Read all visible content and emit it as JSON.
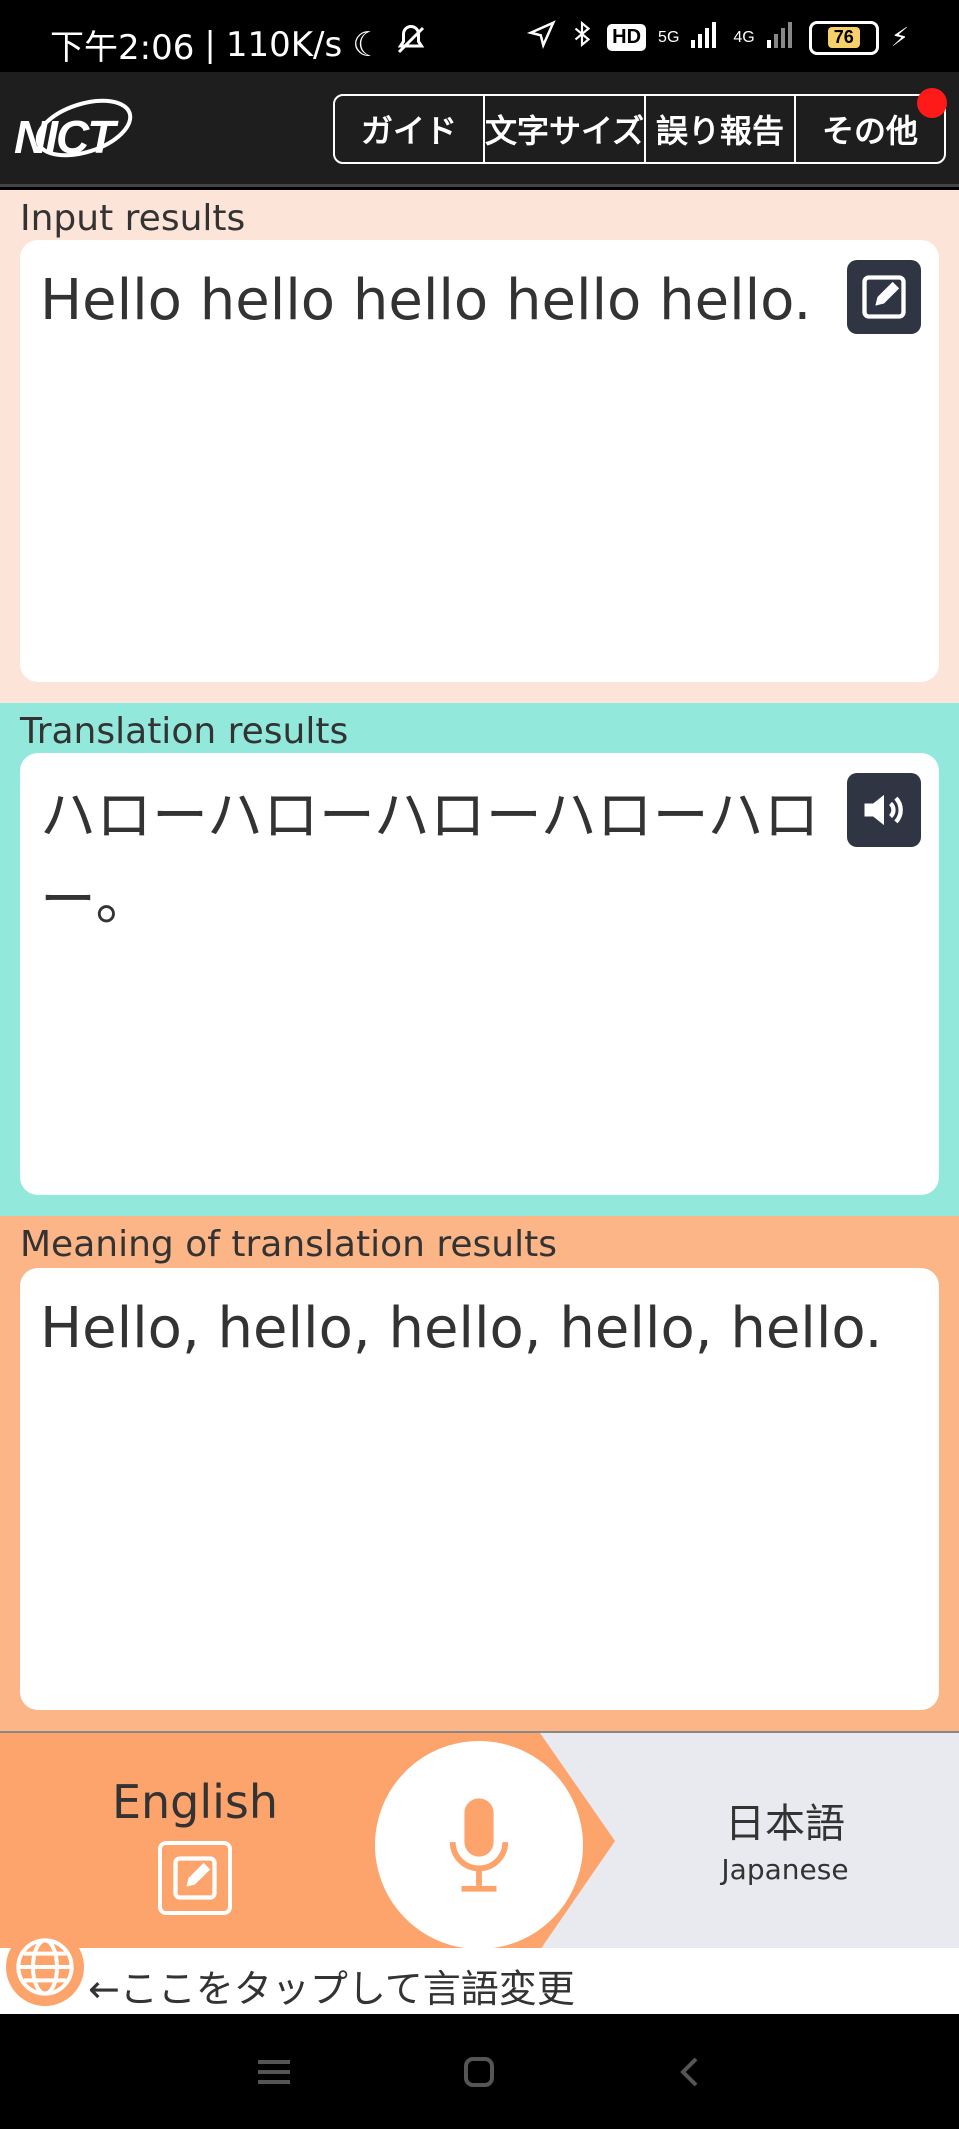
{
  "status_bar": {
    "time": "下午2:06",
    "net_speed": "110K/s",
    "hd_label": "HD",
    "sig1_label": "5G",
    "sig2_label": "4G",
    "battery": "76"
  },
  "header": {
    "logo_text": "NICT",
    "menu": [
      {
        "label": "ガイド"
      },
      {
        "label": "文字サイズ"
      },
      {
        "label": "誤り報告"
      },
      {
        "label": "その他"
      }
    ]
  },
  "input_section": {
    "label": "Input results",
    "text": "Hello hello hello hello hello."
  },
  "translation_section": {
    "label": "Translation results",
    "text": "ハローハローハローハローハロー。"
  },
  "meaning_section": {
    "label": "Meaning of translation results",
    "text": "Hello, hello, hello, hello, hello."
  },
  "language_bar": {
    "source_language": "English",
    "target_language": "日本語",
    "target_language_sub": "Japanese"
  },
  "hint": {
    "text": "←ここをタップして言語変更"
  },
  "colors": {
    "input_bg": "#fde4d8",
    "translation_bg": "#93e8dc",
    "meaning_bg": "#fcb587",
    "accent_orange": "#fda36c",
    "button_dark": "#2f3542"
  }
}
